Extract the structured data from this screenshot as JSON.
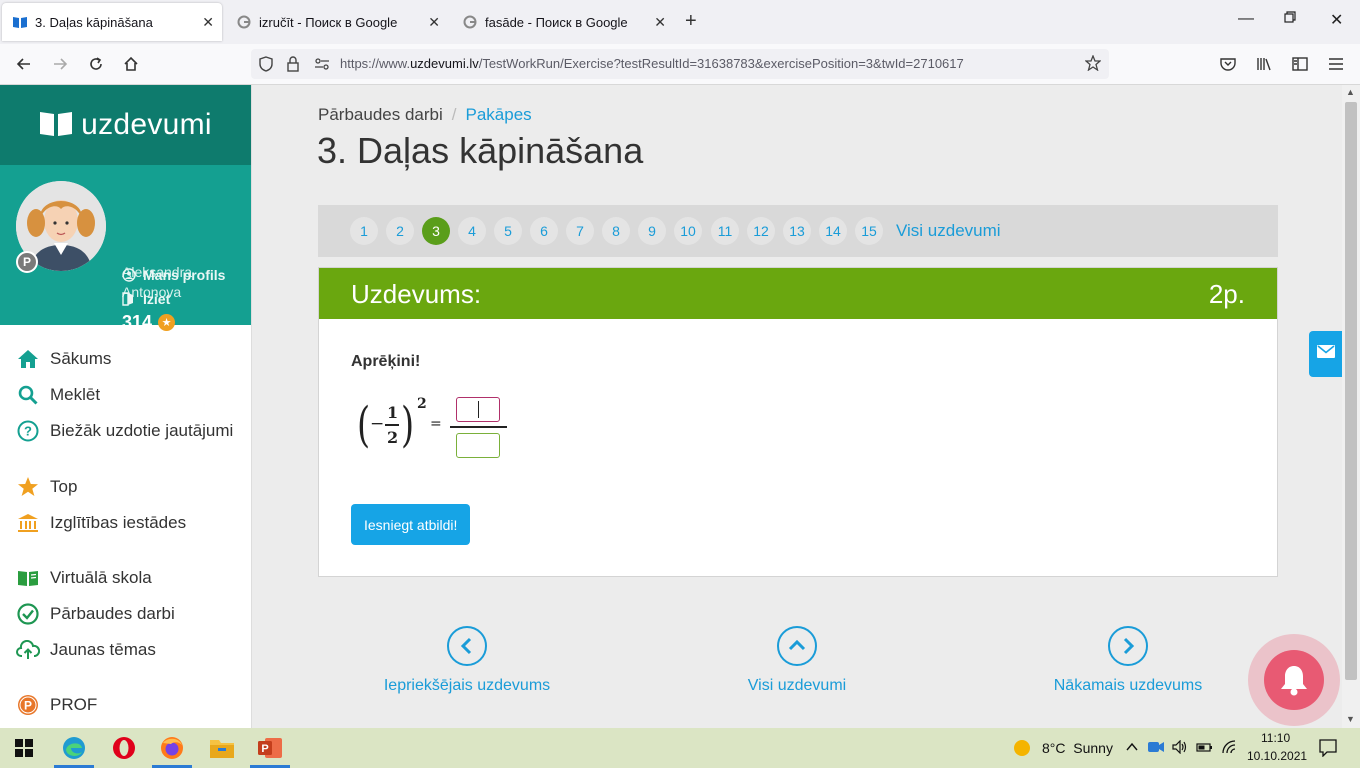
{
  "browser": {
    "tabs": [
      {
        "title": "3. Daļas kāpināšana",
        "active": true
      },
      {
        "title": "izručīt - Поиск в Google",
        "active": false
      },
      {
        "title": "fasāde - Поиск в Google",
        "active": false
      }
    ],
    "url_prefix": "https://www.",
    "url_domain": "uzdevumi.lv",
    "url_path": "/TestWorkRun/Exercise?testResultId=31638783&exercisePosition=3&twId=2710617"
  },
  "sidebar": {
    "logo": "uzdevumi",
    "user": {
      "name": "Aleksandra Antonova",
      "score": "314",
      "badge": "P"
    },
    "profile_links": [
      {
        "label": "Mans profils"
      },
      {
        "label": "Iziet"
      }
    ],
    "menu": [
      {
        "label": "Sākums",
        "icon": "home-icon"
      },
      {
        "label": "Meklēt",
        "icon": "search-icon"
      },
      {
        "label": "Biežāk uzdotie jautājumi",
        "icon": "help-icon"
      },
      {
        "label": "Top",
        "icon": "star-icon"
      },
      {
        "label": "Izglītības iestādes",
        "icon": "institution-icon"
      },
      {
        "label": "Virtuālā skola",
        "icon": "book-icon"
      },
      {
        "label": "Pārbaudes darbi",
        "icon": "check-circle-icon"
      },
      {
        "label": "Jaunas tēmas",
        "icon": "cloud-upload-icon"
      },
      {
        "label": "PROF",
        "icon": "prof-icon"
      }
    ]
  },
  "main": {
    "breadcrumb": {
      "first": "Pārbaudes darbi",
      "sep": "/",
      "second": "Pakāpes"
    },
    "title": "3. Daļas kāpināšana",
    "pager": {
      "pages": [
        "1",
        "2",
        "3",
        "4",
        "5",
        "6",
        "7",
        "8",
        "9",
        "10",
        "11",
        "12",
        "13",
        "14",
        "15"
      ],
      "current": "3",
      "all_label": "Visi uzdevumi"
    },
    "task": {
      "header": "Uzdevums:",
      "points": "2p.",
      "instruction": "Aprēķini!",
      "math": {
        "sign": "−",
        "numerator": "1",
        "denominator": "2",
        "exponent": "2",
        "equals": "="
      },
      "submit": "Iesniegt atbildi!"
    },
    "nav": {
      "prev": "Iepriekšējais uzdevums",
      "all": "Visi uzdevumi",
      "next": "Nākamais uzdevums"
    }
  },
  "taskbar": {
    "weather": "8°C  Sunny",
    "time": "11:10",
    "date": "10.10.2021"
  },
  "colors": {
    "brand_dark": "#0e7b6d",
    "brand": "#14a091",
    "task_green": "#6aa70f",
    "link_blue": "#1a9cd8",
    "button_blue": "#16a4e6"
  }
}
